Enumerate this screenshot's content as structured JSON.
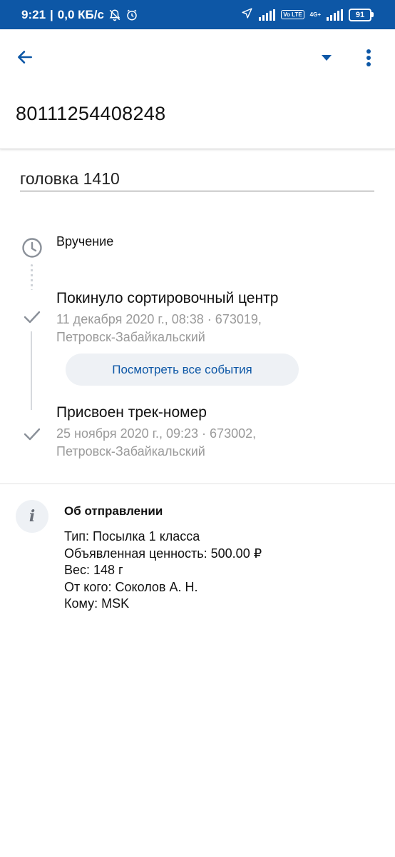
{
  "status_bar": {
    "time": "9:21",
    "speed": "0,0 КБ/с",
    "battery": "91",
    "volte_label": "Vo LTE",
    "network_label": "4G+"
  },
  "header": {
    "track_number": "80111254408248"
  },
  "shipment_name": "головка 1410",
  "timeline": {
    "events": [
      {
        "title": "Вручение",
        "subtitle_1": "",
        "subtitle_2": "",
        "state": "pending"
      },
      {
        "title": "Покинуло сортировочный центр",
        "subtitle_1": "11 декабря 2020 г., 08:38 · 673019,",
        "subtitle_2": "Петровск-Забайкальский",
        "state": "done"
      },
      {
        "title": "Присвоен трек-номер",
        "subtitle_1": "25 ноября 2020 г., 09:23 · 673002,",
        "subtitle_2": "Петровск-Забайкальский",
        "state": "done"
      }
    ],
    "all_events_label": "Посмотреть все события"
  },
  "info": {
    "icon_letter": "i",
    "title": "Об отправлении",
    "lines": [
      "Тип: Посылка 1 класса",
      "Объявленная ценность: 500.00 ₽",
      "Вес: 148 г",
      "От кого: Соколов А. Н.",
      "Кому: MSK"
    ]
  },
  "colors": {
    "brand": "#0d57a6",
    "muted_text": "#9a9a9a",
    "chip_bg": "#eef1f5"
  },
  "icons": {
    "back": "arrow-left-icon",
    "dropdown": "triangle-down-icon",
    "more": "more-vertical-icon",
    "pending": "clock-icon",
    "done": "check-icon",
    "info": "info-icon"
  }
}
